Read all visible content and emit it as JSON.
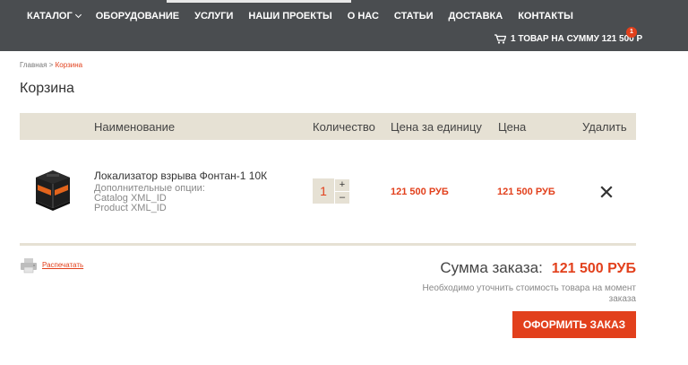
{
  "nav": {
    "items": [
      {
        "label": "КАТАЛОГ"
      },
      {
        "label": "ОБОРУДОВАНИЕ"
      },
      {
        "label": "УСЛУГИ"
      },
      {
        "label": "НАШИ ПРОЕКТЫ"
      },
      {
        "label": "О НАС"
      },
      {
        "label": "СТАТЬИ"
      },
      {
        "label": "ДОСТАВКА"
      },
      {
        "label": "КОНТАКТЫ"
      }
    ],
    "catalog_caret_icon": "chevron-down-icon"
  },
  "cart": {
    "icon": "cart-icon",
    "summary": "1 ТОВАР НА СУММУ 121 500 Р",
    "badge_count": "1"
  },
  "breadcrumb": {
    "home": "Главная",
    "separator": ">",
    "current": "Корзина"
  },
  "page_title": "Корзина",
  "table": {
    "headers": {
      "name": "Наименование",
      "quantity": "Количество",
      "unit_price": "Цена за единицу",
      "price": "Цена",
      "delete": "Удалить"
    },
    "rows": [
      {
        "image": "product-thumbnail",
        "name": "Локализатор взрыва Фонтан-1 10К",
        "options_title": "Дополнительные опции:",
        "options": [
          "Catalog XML_ID",
          "Product XML_ID"
        ],
        "quantity": "1",
        "plus": "+",
        "minus": "–",
        "unit_price": "121 500 РУБ",
        "price": "121 500 РУБ",
        "delete_icon": "close-icon"
      }
    ]
  },
  "print": {
    "icon": "printer-icon",
    "label": "Распечатать"
  },
  "order": {
    "sum_label": "Сумма заказа:",
    "sum_value": "121 500 РУБ",
    "note": "Необходимо уточнить стоимость товара на момент заказа",
    "checkout_label": "ОФОРМИТЬ ЗАКАЗ"
  },
  "colors": {
    "topbar": "#4a4d50",
    "accent": "#e2401c",
    "table_header": "#e6e1d4"
  }
}
